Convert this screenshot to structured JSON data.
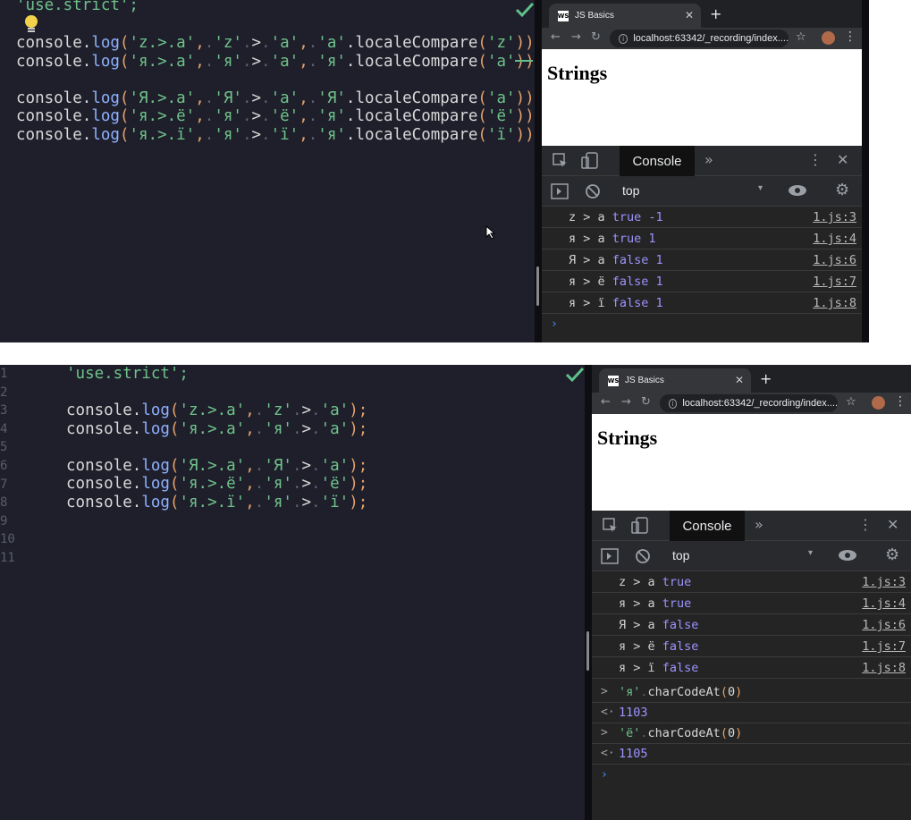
{
  "colors": {
    "editor_bg": "#1e1f2b",
    "string": "#6fc28a",
    "method": "#8fb1ff",
    "punctuation": "#e5a26a",
    "console_value": "#9c93ff",
    "check": "#5fc08a"
  },
  "top": {
    "editor": {
      "use_strict": "'use.strict';",
      "lines": [
        "console.log('z.>.a',.'z'.>.'a',.'a'.localeCompare('z'));",
        "console.log('я.>.a',.'я'.>.'a',.'я'.localeCompare('a'));",
        "",
        "console.log('Я.>.a',.'Я'.>.'a',.'Я'.localeCompare('a'));",
        "console.log('я.>.ё',.'я'.>.'ё',.'я'.localeCompare('ё'));",
        "console.log('я.>.ї',.'я'.>.'ї',.'я'.localeCompare('ї'));"
      ]
    },
    "browser": {
      "tab_title": "JS Basics",
      "favicon": "WS",
      "url": "localhost:63342/_recording/index....",
      "page_heading": "Strings",
      "devtools_tab": "Console",
      "context": "top",
      "logs": [
        {
          "msg": "z > a ",
          "val": "true -1",
          "src": "1.js:3"
        },
        {
          "msg": "я > a ",
          "val": "true 1",
          "src": "1.js:4"
        },
        {
          "msg": "Я > a ",
          "val": "false 1",
          "src": "1.js:6"
        },
        {
          "msg": "я > ё ",
          "val": "false 1",
          "src": "1.js:7"
        },
        {
          "msg": "я > ї ",
          "val": "false 1",
          "src": "1.js:8"
        }
      ]
    }
  },
  "bottom": {
    "editor": {
      "line_numbers": [
        "1",
        "2",
        "3",
        "4",
        "5",
        "6",
        "7",
        "8",
        "9",
        "10",
        "11"
      ],
      "use_strict": "'use.strict';",
      "lines": [
        "console.log('z.>.a',.'z'.>.'a');",
        "console.log('я.>.a',.'я'.>.'a');",
        "",
        "console.log('Я.>.a',.'Я'.>.'a');",
        "console.log('я.>.ё',.'я'.>.'ё');",
        "console.log('я.>.ї',.'я'.>.'ї');"
      ]
    },
    "browser": {
      "tab_title": "JS Basics",
      "favicon": "WS",
      "url": "localhost:63342/_recording/index....",
      "page_heading": "Strings",
      "devtools_tab": "Console",
      "context": "top",
      "logs": [
        {
          "msg": "z > a ",
          "val": "true",
          "src": "1.js:3"
        },
        {
          "msg": "я > a ",
          "val": "true",
          "src": "1.js:4"
        },
        {
          "msg": "Я > a ",
          "val": "false",
          "src": "1.js:6"
        },
        {
          "msg": "я > ё ",
          "val": "false",
          "src": "1.js:7"
        },
        {
          "msg": "я > ї ",
          "val": "false",
          "src": "1.js:8"
        }
      ],
      "commands": [
        {
          "input": "'я'.charCodeAt(0)",
          "result": "1103"
        },
        {
          "input": "'ё'.charCodeAt(0)",
          "result": "1105"
        }
      ]
    }
  }
}
